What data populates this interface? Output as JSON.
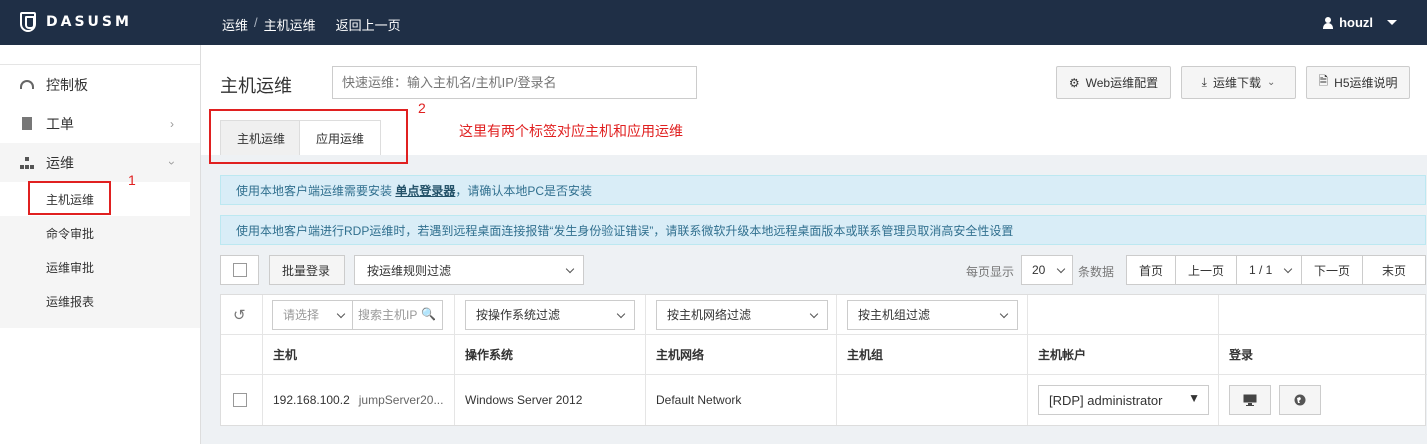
{
  "app": {
    "logo": "DASUSM"
  },
  "breadcrumb": {
    "item1": "运维",
    "sep": "/",
    "item2": "主机运维",
    "back": "返回上一页"
  },
  "user": {
    "name": "houzl"
  },
  "sidebar": {
    "items": [
      {
        "label": "控制板",
        "icon": "dashboard-icon"
      },
      {
        "label": "工单",
        "icon": "document-icon"
      },
      {
        "label": "运维",
        "icon": "sitemap-icon"
      }
    ],
    "submenu": [
      "主机运维",
      "命令审批",
      "运维审批",
      "运维报表"
    ]
  },
  "header": {
    "title": "主机运维",
    "search_placeholder": "快速运维：输入主机名/主机IP/登录名",
    "web_config": "Web运维配置",
    "download": "运维下载",
    "h5_help": "H5运维说明"
  },
  "tabs": [
    "主机运维",
    "应用运维"
  ],
  "alerts": {
    "a1_prefix": "使用本地客户端运维需要安装",
    "a1_link": "单点登录器",
    "a1_suffix": "，请确认本地PC是否安装",
    "a2": "使用本地客户端进行RDP运维时，若遇到远程桌面连接报错“发生身份验证错误”，请联系微软升级本地远程桌面版本或联系管理员取消高安全性设置"
  },
  "toolbar": {
    "batch_login": "批量登录",
    "rule_filter": "按运维规则过滤",
    "per_page_label": "每页显示",
    "per_page": "20",
    "records_label": "条数据",
    "first": "首页",
    "prev": "上一页",
    "page": "1 / 1",
    "next": "下一页",
    "last": "末页"
  },
  "filters": {
    "select_placeholder": "请选择",
    "host_search_placeholder": "搜索主机IP",
    "os": "按操作系统过滤",
    "network": "按主机网络过滤",
    "group": "按主机组过滤"
  },
  "columns": [
    "主机",
    "操作系统",
    "主机网络",
    "主机组",
    "主机帐户",
    "登录"
  ],
  "rows": [
    {
      "ip": "192.168.100.2",
      "name": "jumpServer20...",
      "os": "Windows Server 2012",
      "network": "Default Network",
      "group": "",
      "account": "[RDP] administrator"
    }
  ],
  "annotations": {
    "n1": "1",
    "n2": "2",
    "note": "这里有两个标签对应主机和应用运维"
  }
}
